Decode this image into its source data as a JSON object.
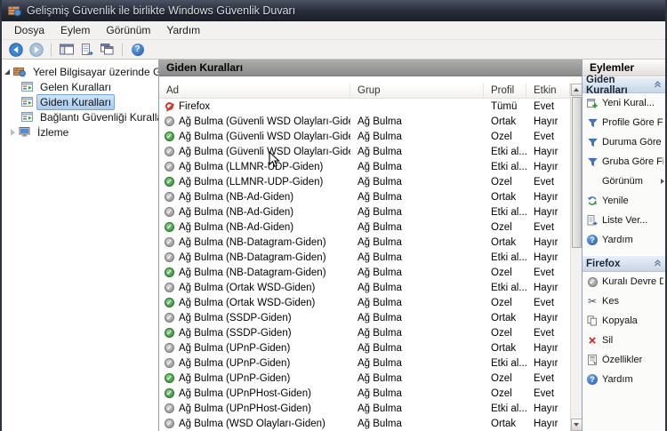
{
  "window": {
    "title": "Gelişmiş Güvenlik ile birlikte Windows Güvenlik Duvarı"
  },
  "menu": {
    "items": [
      "Dosya",
      "Eylem",
      "Görünüm",
      "Yardım"
    ]
  },
  "toolbar": {
    "buttons": [
      "back",
      "forward",
      "console-tree-toggle",
      "export-list",
      "new-window",
      "help"
    ]
  },
  "tree": {
    "root": "Yerel Bilgisayar üzerinde Gelişm",
    "items": [
      {
        "label": "Gelen Kuralları",
        "selected": false,
        "collapsed": false
      },
      {
        "label": "Giden Kuralları",
        "selected": true,
        "collapsed": false
      },
      {
        "label": "Bağlantı Güvenliği Kuralları",
        "selected": false,
        "collapsed": false
      },
      {
        "label": "İzleme",
        "selected": false,
        "collapsed": true
      }
    ]
  },
  "list": {
    "title": "Giden Kuralları",
    "columns": [
      "Ad",
      "Grup",
      "Profil",
      "Etkin"
    ],
    "rows": [
      {
        "name": "Firefox",
        "group": "",
        "profile": "Tümü",
        "enabled": "Evet",
        "icon": "blocked"
      },
      {
        "name": "Ağ Bulma (Güvenli WSD Olayları-Giden)",
        "group": "Ağ Bulma",
        "profile": "Ortak",
        "enabled": "Hayır",
        "icon": "disabled"
      },
      {
        "name": "Ağ Bulma (Güvenli WSD Olayları-Giden)",
        "group": "Ağ Bulma",
        "profile": "Özel",
        "enabled": "Evet",
        "icon": "enabled"
      },
      {
        "name": "Ağ Bulma (Güvenli WSD Olayları-Giden)",
        "group": "Ağ Bulma",
        "profile": "Etki al...",
        "enabled": "Hayır",
        "icon": "disabled"
      },
      {
        "name": "Ağ Bulma (LLMNR-UDP-Giden)",
        "group": "Ağ Bulma",
        "profile": "Etki al...",
        "enabled": "Hayır",
        "icon": "disabled"
      },
      {
        "name": "Ağ Bulma (LLMNR-UDP-Giden)",
        "group": "Ağ Bulma",
        "profile": "Özel",
        "enabled": "Evet",
        "icon": "enabled"
      },
      {
        "name": "Ağ Bulma (NB-Ad-Giden)",
        "group": "Ağ Bulma",
        "profile": "Ortak",
        "enabled": "Hayır",
        "icon": "disabled"
      },
      {
        "name": "Ağ Bulma (NB-Ad-Giden)",
        "group": "Ağ Bulma",
        "profile": "Etki al...",
        "enabled": "Hayır",
        "icon": "disabled"
      },
      {
        "name": "Ağ Bulma (NB-Ad-Giden)",
        "group": "Ağ Bulma",
        "profile": "Özel",
        "enabled": "Evet",
        "icon": "enabled"
      },
      {
        "name": "Ağ Bulma (NB-Datagram-Giden)",
        "group": "Ağ Bulma",
        "profile": "Ortak",
        "enabled": "Hayır",
        "icon": "disabled"
      },
      {
        "name": "Ağ Bulma (NB-Datagram-Giden)",
        "group": "Ağ Bulma",
        "profile": "Etki al...",
        "enabled": "Hayır",
        "icon": "disabled"
      },
      {
        "name": "Ağ Bulma (NB-Datagram-Giden)",
        "group": "Ağ Bulma",
        "profile": "Özel",
        "enabled": "Evet",
        "icon": "enabled"
      },
      {
        "name": "Ağ Bulma (Ortak WSD-Giden)",
        "group": "Ağ Bulma",
        "profile": "Etki al...",
        "enabled": "Hayır",
        "icon": "disabled"
      },
      {
        "name": "Ağ Bulma (Ortak WSD-Giden)",
        "group": "Ağ Bulma",
        "profile": "Özel",
        "enabled": "Evet",
        "icon": "enabled"
      },
      {
        "name": "Ağ Bulma (SSDP-Giden)",
        "group": "Ağ Bulma",
        "profile": "Ortak",
        "enabled": "Hayır",
        "icon": "disabled"
      },
      {
        "name": "Ağ Bulma (SSDP-Giden)",
        "group": "Ağ Bulma",
        "profile": "Özel",
        "enabled": "Evet",
        "icon": "enabled"
      },
      {
        "name": "Ağ Bulma (UPnP-Giden)",
        "group": "Ağ Bulma",
        "profile": "Ortak",
        "enabled": "Hayır",
        "icon": "disabled"
      },
      {
        "name": "Ağ Bulma (UPnP-Giden)",
        "group": "Ağ Bulma",
        "profile": "Etki al...",
        "enabled": "Hayır",
        "icon": "disabled"
      },
      {
        "name": "Ağ Bulma (UPnP-Giden)",
        "group": "Ağ Bulma",
        "profile": "Özel",
        "enabled": "Evet",
        "icon": "enabled"
      },
      {
        "name": "Ağ Bulma (UPnPHost-Giden)",
        "group": "Ağ Bulma",
        "profile": "Özel",
        "enabled": "Evet",
        "icon": "enabled"
      },
      {
        "name": "Ağ Bulma (UPnPHost-Giden)",
        "group": "Ağ Bulma",
        "profile": "Etki al...",
        "enabled": "Hayır",
        "icon": "disabled"
      },
      {
        "name": "Ağ Bulma (WSD Olayları-Giden)",
        "group": "Ağ Bulma",
        "profile": "Ortak",
        "enabled": "Hayır",
        "icon": "disabled"
      }
    ]
  },
  "actions": {
    "title": "Eylemler",
    "sections": [
      {
        "header": "Giden Kuralları",
        "items": [
          {
            "label": "Yeni Kural...",
            "icon": "new-rule",
            "submenu": false
          },
          {
            "label": "Profile Göre Fil...",
            "icon": "filter",
            "submenu": false
          },
          {
            "label": "Duruma Göre F...",
            "icon": "filter",
            "submenu": false
          },
          {
            "label": "Gruba Göre Fil...",
            "icon": "filter",
            "submenu": false
          },
          {
            "label": "Görünüm",
            "icon": "none",
            "submenu": true
          },
          {
            "label": "Yenile",
            "icon": "refresh",
            "submenu": false
          },
          {
            "label": "Liste Ver...",
            "icon": "export-list",
            "submenu": false
          },
          {
            "label": "Yardım",
            "icon": "help",
            "submenu": false
          }
        ]
      },
      {
        "header": "Firefox",
        "items": [
          {
            "label": "Kuralı Devre Dı...",
            "icon": "disable-rule",
            "submenu": false
          },
          {
            "label": "Kes",
            "icon": "cut",
            "submenu": false
          },
          {
            "label": "Kopyala",
            "icon": "copy",
            "submenu": false
          },
          {
            "label": "Sil",
            "icon": "delete",
            "submenu": false
          },
          {
            "label": "Özellikler",
            "icon": "properties",
            "submenu": false
          },
          {
            "label": "Yardım",
            "icon": "help",
            "submenu": false
          }
        ]
      }
    ]
  },
  "colors": {
    "titlebar": "#272b36",
    "selection_blue": "#a6cbee",
    "enabled_green": "#2f8f2f",
    "disabled_gray": "#8f8f8f",
    "blocked_red": "#d6352a",
    "accent_blue": "#2f6fc1",
    "pane_header_gray": "#9b9b9b"
  }
}
